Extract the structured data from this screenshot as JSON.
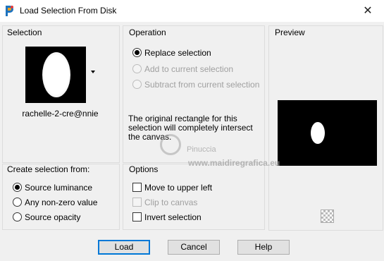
{
  "window": {
    "title": "Load Selection From Disk",
    "app_icon": "paintshop-pro-icon",
    "close_glyph": "✕"
  },
  "selection": {
    "label": "Selection",
    "thumbnail_name": "rachelle-2-cre@nnie"
  },
  "operation": {
    "label": "Operation",
    "options": [
      {
        "label": "Replace selection",
        "checked": true,
        "enabled": true
      },
      {
        "label": "Add to current selection",
        "checked": false,
        "enabled": false
      },
      {
        "label": "Subtract from current selection",
        "checked": false,
        "enabled": false
      }
    ],
    "info": "The original rectangle for this selection will completely intersect the canvas."
  },
  "preview": {
    "label": "Preview"
  },
  "create_from": {
    "label": "Create selection from:",
    "options": [
      {
        "label": "Source luminance",
        "checked": true
      },
      {
        "label": "Any non-zero value",
        "checked": false
      },
      {
        "label": "Source opacity",
        "checked": false
      }
    ]
  },
  "options": {
    "label": "Options",
    "checks": [
      {
        "label": "Move to upper left",
        "checked": false,
        "enabled": true
      },
      {
        "label": "Clip to canvas",
        "checked": false,
        "enabled": false
      },
      {
        "label": "Invert selection",
        "checked": false,
        "enabled": true
      }
    ]
  },
  "watermark": {
    "name": "Pinuccia",
    "url": "www.maidiregrafica.eu"
  },
  "buttons": {
    "load": "Load",
    "cancel": "Cancel",
    "help": "Help"
  }
}
